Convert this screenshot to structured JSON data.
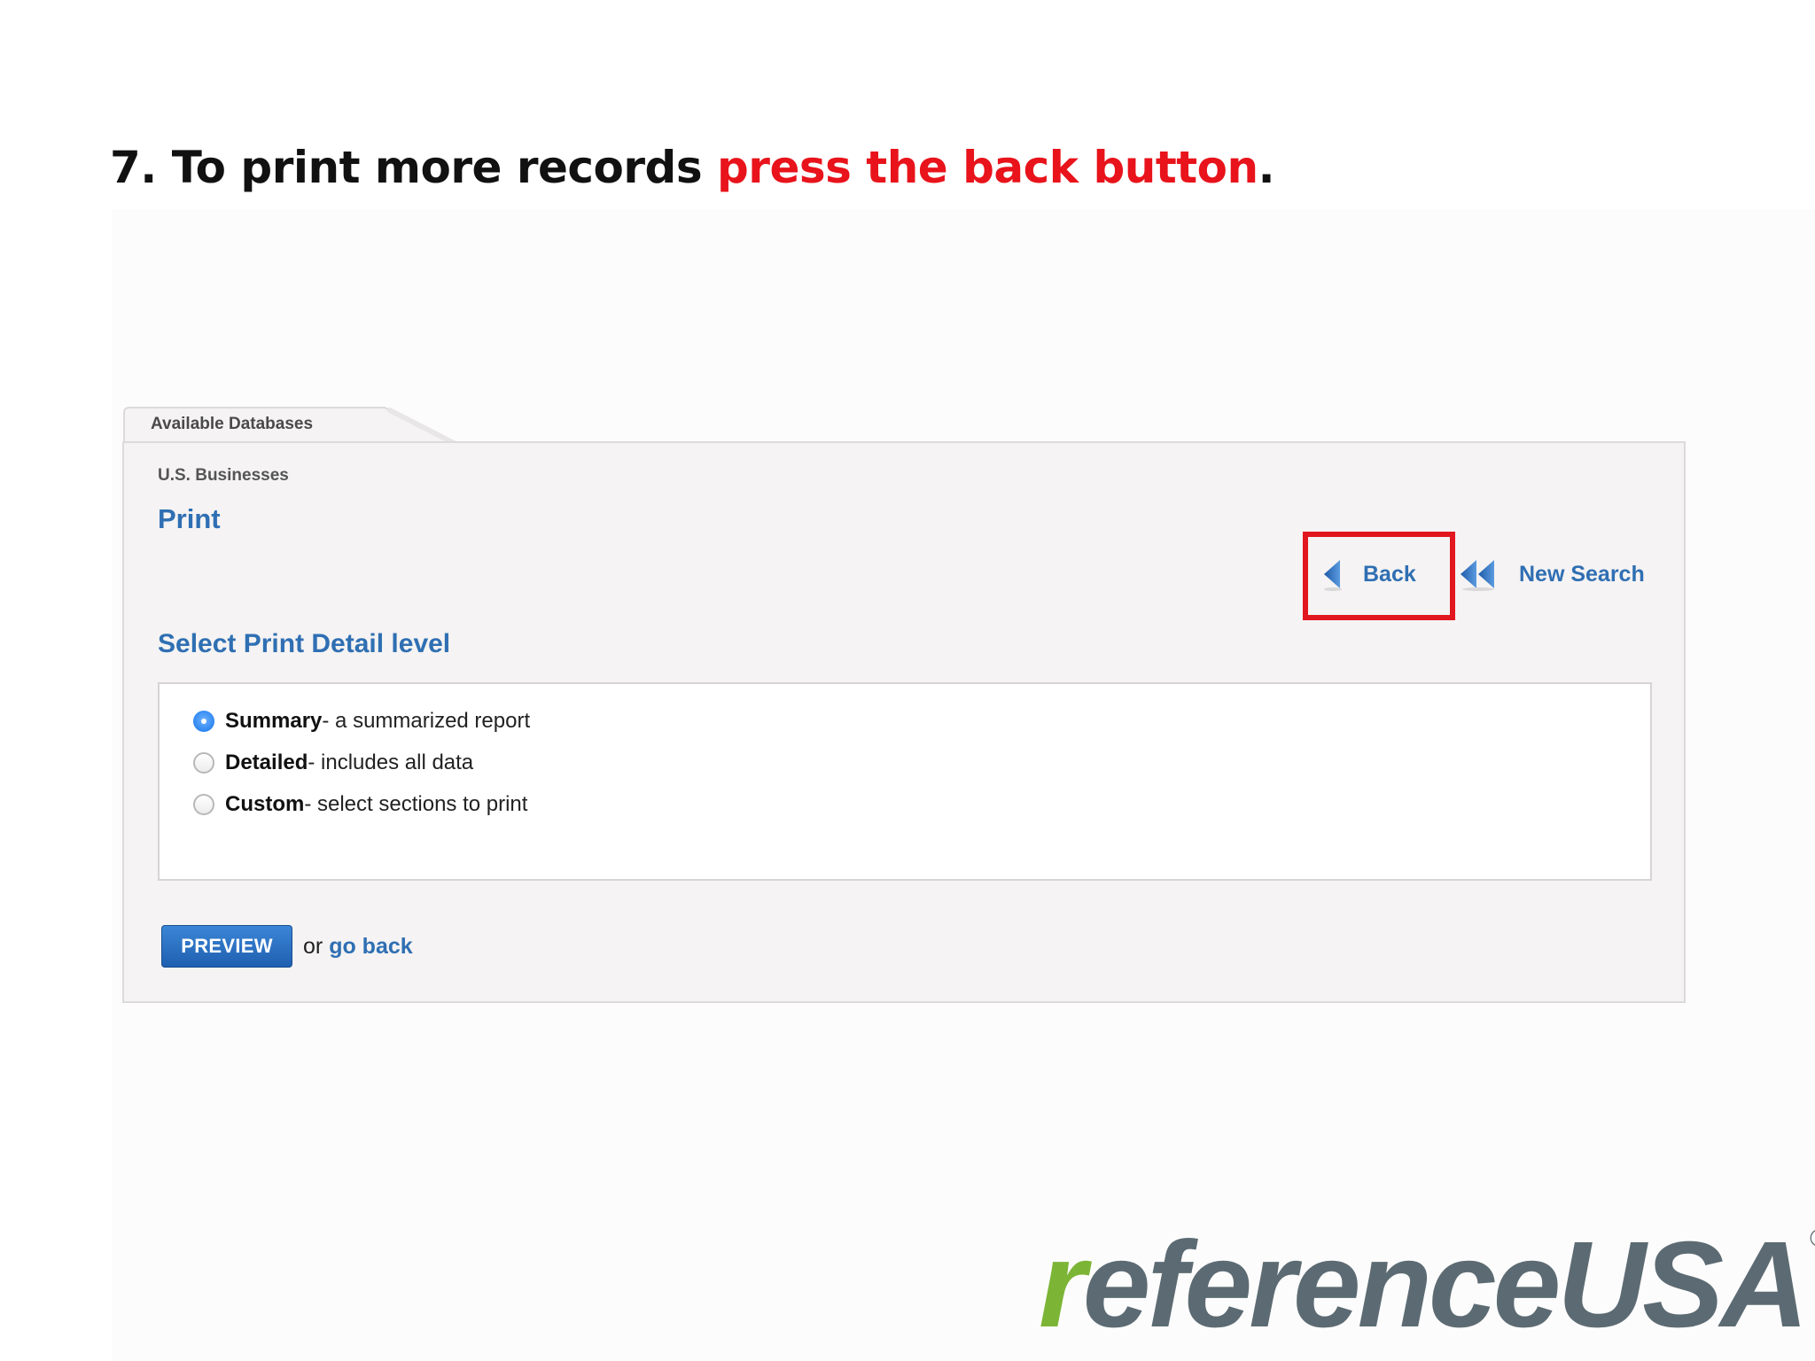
{
  "instruction": {
    "prefix": "7. To print more records ",
    "highlight": "press the back button",
    "suffix": "."
  },
  "tab": {
    "label": "Available Databases"
  },
  "panel": {
    "database": "U.S. Businesses",
    "title": "Print",
    "nav": {
      "back_label": "Back",
      "new_search_label": "New Search"
    },
    "section_title": "Select Print Detail level",
    "options": [
      {
        "name": "Summary",
        "description": " - a summarized report",
        "checked": true
      },
      {
        "name": "Detailed",
        "description": " - includes all data",
        "checked": false
      },
      {
        "name": "Custom",
        "description": " - select sections to print",
        "checked": false
      }
    ],
    "preview_label": "PREVIEW",
    "or_text": "or ",
    "go_back_label": "go back"
  },
  "logo": {
    "r": "r",
    "rest": "eferenceUSA",
    "reg": "®"
  },
  "colors": {
    "highlight_red": "#e8131b",
    "link_blue": "#2f6fb3",
    "logo_green": "#7cb536",
    "logo_gray": "#5c6b73"
  }
}
